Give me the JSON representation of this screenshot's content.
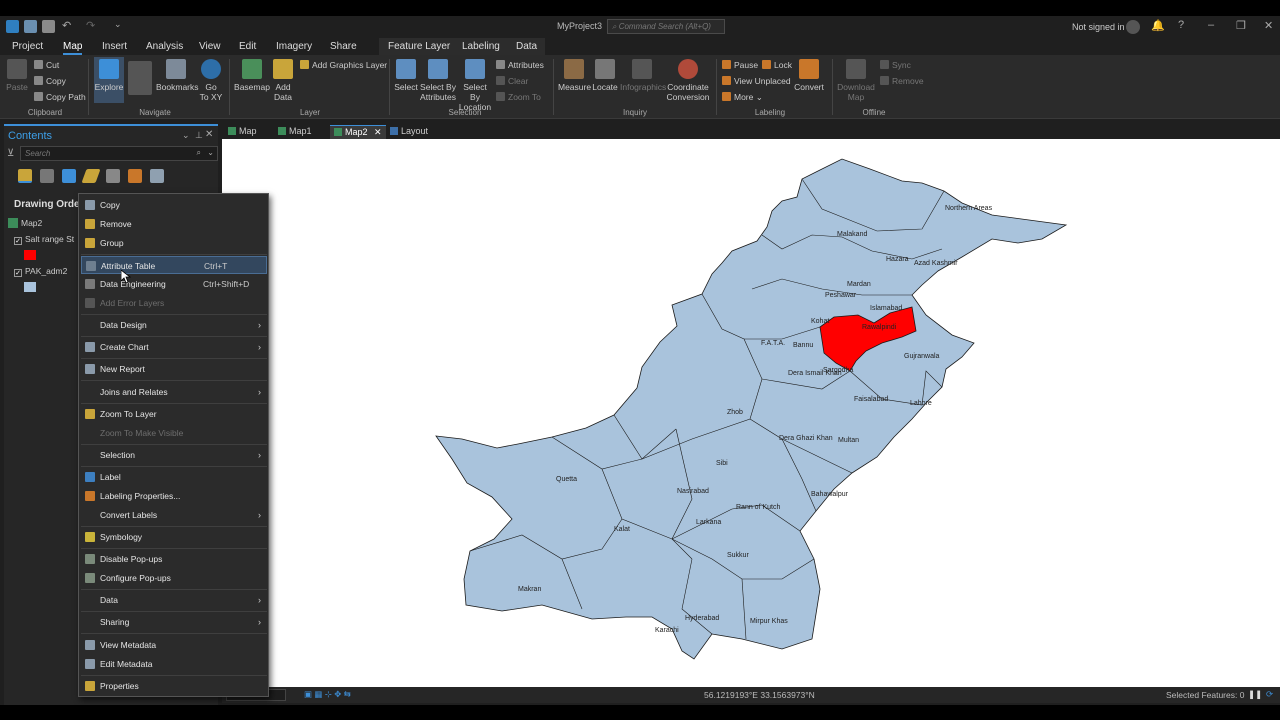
{
  "title_bar": {
    "project": "MyProject3",
    "command_search": "Command Search (Alt+Q)",
    "sign_in": "Not signed in",
    "help": "?"
  },
  "menu_tabs": [
    "Project",
    "Map",
    "Insert",
    "Analysis",
    "View",
    "Edit",
    "Imagery",
    "Share",
    "Feature Layer",
    "Labeling",
    "Data"
  ],
  "ribbon": {
    "clipboard": {
      "paste": "Paste",
      "cut": "Cut",
      "copy": "Copy",
      "copy_path": "Copy Path",
      "group": "Clipboard"
    },
    "navigate": {
      "explore": "Explore",
      "bookmarks": "Bookmarks",
      "go_to_xy_1": "Go",
      "go_to_xy_2": "To XY",
      "group": "Navigate"
    },
    "layer": {
      "basemap": "Basemap",
      "add_data_1": "Add",
      "add_data_2": "Data",
      "add_graphics": "Add Graphics Layer",
      "group": "Layer"
    },
    "selection": {
      "select": "Select",
      "by_attr_1": "Select By",
      "by_attr_2": "Attributes",
      "by_loc_1": "Select By",
      "by_loc_2": "Location",
      "attributes": "Attributes",
      "clear": "Clear",
      "zoom_to": "Zoom To",
      "group": "Selection"
    },
    "inquiry": {
      "measure": "Measure",
      "locate": "Locate",
      "infographics": "Infographics",
      "coord_1": "Coordinate",
      "coord_2": "Conversion",
      "group": "Inquiry"
    },
    "labeling": {
      "pause": "Pause",
      "lock": "Lock",
      "view_unplaced": "View Unplaced",
      "more": "More",
      "convert": "Convert",
      "group": "Labeling"
    },
    "offline": {
      "download_1": "Download",
      "download_2": "Map",
      "sync": "Sync",
      "remove": "Remove",
      "group": "Offline"
    }
  },
  "contents": {
    "title": "Contents",
    "search_placeholder": "Search",
    "drawing_order": "Drawing Order",
    "map_name": "Map2",
    "layers": [
      {
        "name": "Salt range St",
        "swatch": "#ff0000"
      },
      {
        "name": "PAK_adm2",
        "swatch": "#a9c3dc"
      }
    ]
  },
  "view_tabs": [
    "Map",
    "Map1",
    "Map2",
    "Layout"
  ],
  "context_menu": [
    {
      "label": "Copy",
      "icon": "copy-icon"
    },
    {
      "label": "Remove",
      "icon": "remove-icon"
    },
    {
      "label": "Group",
      "icon": "group-icon"
    },
    {
      "label": "Attribute Table",
      "shortcut": "Ctrl+T",
      "icon": "table-icon"
    },
    {
      "label": "Data Engineering",
      "shortcut": "Ctrl+Shift+D",
      "icon": "data-engineering-icon"
    },
    {
      "label": "Add Error Layers",
      "icon": "error-layers-icon"
    },
    {
      "label": "Data Design",
      "submenu": true
    },
    {
      "label": "Create Chart",
      "icon": "chart-icon",
      "submenu": true
    },
    {
      "label": "New Report",
      "icon": "report-icon"
    },
    {
      "label": "Joins and Relates",
      "submenu": true
    },
    {
      "label": "Zoom To Layer",
      "icon": "zoom-layer-icon"
    },
    {
      "label": "Zoom To Make Visible"
    },
    {
      "label": "Selection",
      "submenu": true
    },
    {
      "label": "Label",
      "icon": "label-icon"
    },
    {
      "label": "Labeling Properties...",
      "icon": "labeling-properties-icon"
    },
    {
      "label": "Convert Labels",
      "submenu": true
    },
    {
      "label": "Symbology",
      "icon": "symbology-icon"
    },
    {
      "label": "Disable Pop-ups",
      "icon": "disable-popups-icon"
    },
    {
      "label": "Configure Pop-ups",
      "icon": "configure-popups-icon"
    },
    {
      "label": "Data",
      "submenu": true
    },
    {
      "label": "Sharing",
      "submenu": true
    },
    {
      "label": "View Metadata",
      "icon": "view-metadata-icon"
    },
    {
      "label": "Edit Metadata",
      "icon": "edit-metadata-icon"
    },
    {
      "label": "Properties",
      "icon": "properties-icon"
    }
  ],
  "map_labels": [
    "Northern Areas",
    "Malakand",
    "Hazara",
    "Azad Kashmir",
    "Mardan",
    "Peshawar",
    "Islamabad",
    "Kohat",
    "Rawalpindi",
    "F.A.T.A.",
    "Bannu",
    "Sargodha",
    "Gujranwala",
    "Dera Ismail Khan",
    "Faisalabad",
    "Lahore",
    "Zhob",
    "Dera Ghazi Khan",
    "Multan",
    "Sibi",
    "Quetta",
    "Nasirabad",
    "Bahawalpur",
    "Rann of Kutch",
    "Kalat",
    "Larkana",
    "Sukkur",
    "Makran",
    "Hyderabad",
    "Mirpur Khas",
    "Karachi"
  ],
  "status_bar": {
    "coordinates": "56.1219193°E 33.1563973°N",
    "selected_features": "Selected Features: 0"
  },
  "colors": {
    "accent": "#3d8fd8",
    "province_fill": "#a9c3dc",
    "selection_fill": "#ff0000"
  }
}
